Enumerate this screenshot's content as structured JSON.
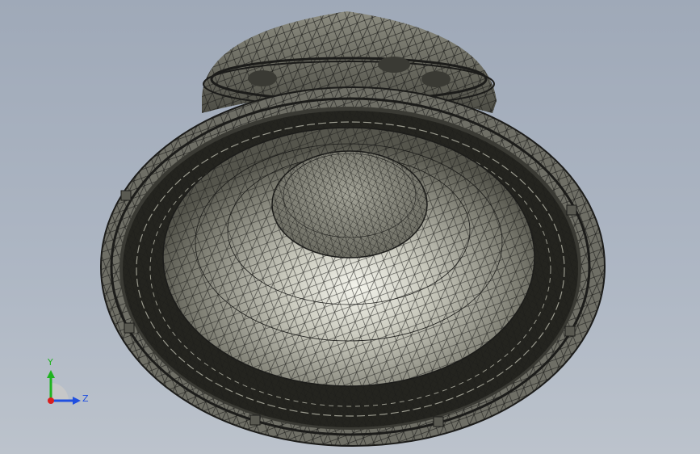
{
  "viewport": {
    "model_name": "speaker-mesh",
    "colors": {
      "background_top": "#9fa9b8",
      "background_bottom": "#bcc3cc",
      "model_fill": "#8e8e82",
      "model_dark": "#2a2a26",
      "model_highlight": "#f2f2ea",
      "mesh_line": "#1c1c1a"
    }
  },
  "triad": {
    "y_label": "Y",
    "z_label": "Z",
    "colors": {
      "y": "#1fb31f",
      "z": "#1f4fe0",
      "x": "#d81f1f"
    }
  }
}
